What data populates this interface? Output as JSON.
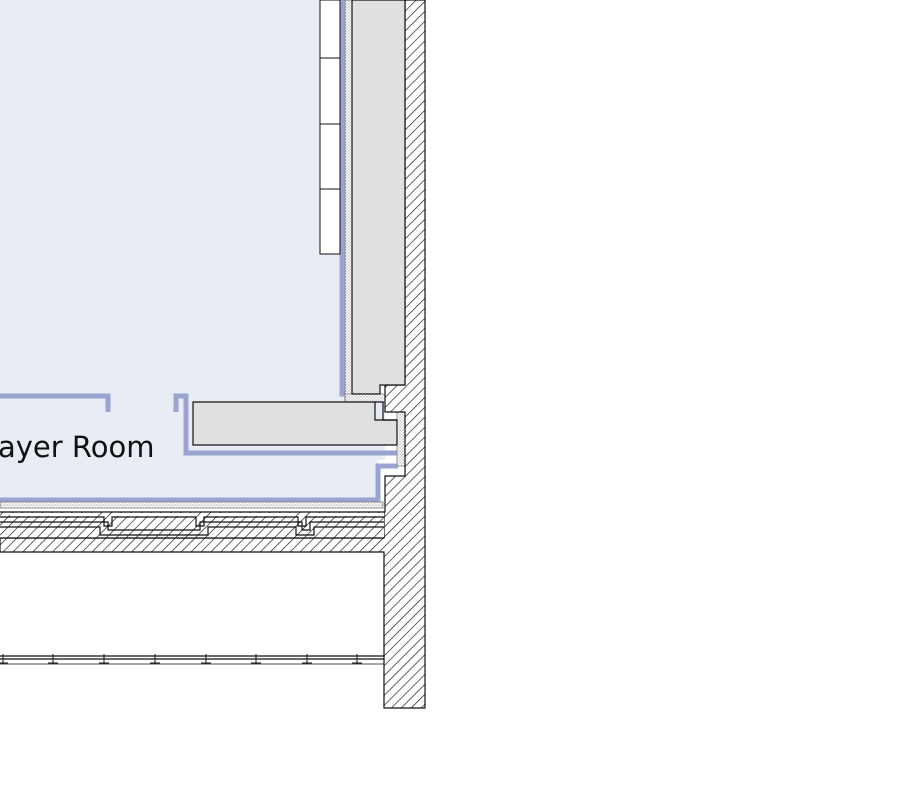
{
  "room": {
    "label": "ayer Room"
  },
  "colors": {
    "room_fill": "#e8ecf5",
    "room_outline": "#9ba3d0",
    "wall_hatch": "#222222",
    "column_fill": "#e0e0e0",
    "line": "#111111",
    "stipple": "#888888"
  }
}
